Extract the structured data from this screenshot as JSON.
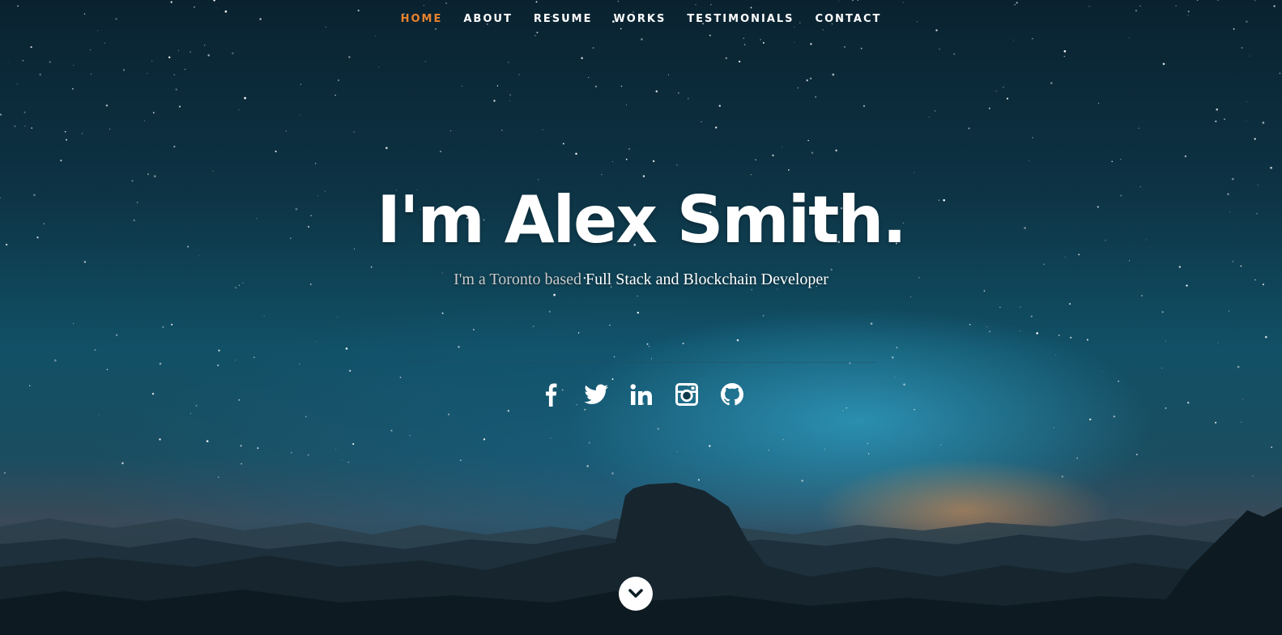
{
  "nav": {
    "items": [
      {
        "label": "Home",
        "active": true
      },
      {
        "label": "About",
        "active": false
      },
      {
        "label": "Resume",
        "active": false
      },
      {
        "label": "Works",
        "active": false
      },
      {
        "label": "Testimonials",
        "active": false
      },
      {
        "label": "Contact",
        "active": false
      }
    ]
  },
  "banner": {
    "headline": "I'm Alex Smith.",
    "tagline_prefix": "I'm a Toronto based ",
    "tagline_highlight": "Full Stack and Blockchain Developer"
  },
  "social": [
    {
      "icon": "facebook-icon"
    },
    {
      "icon": "twitter-icon"
    },
    {
      "icon": "linkedin-icon"
    },
    {
      "icon": "instagram-icon"
    },
    {
      "icon": "github-icon"
    }
  ],
  "scroll_down": {
    "icon": "chevron-down-icon"
  },
  "colors": {
    "accent": "#e8832e",
    "text": "#ffffff",
    "tagline_muted": "#c9c9c9",
    "sky_top": "#0a2230",
    "sky_glow": "#3cbee6"
  }
}
